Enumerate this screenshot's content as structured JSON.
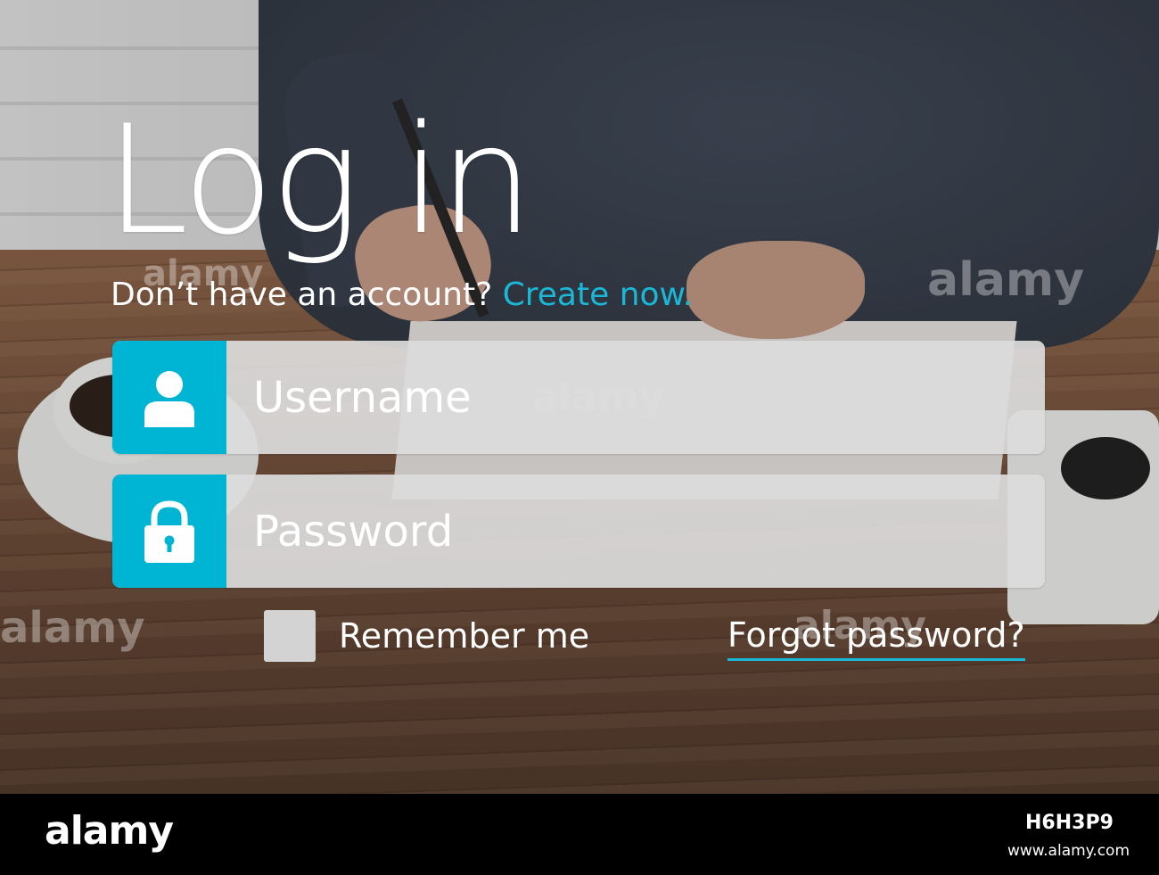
{
  "login": {
    "title": "Log in",
    "signup_prompt": "Don’t have an account?",
    "signup_link": "Create now.",
    "username_placeholder": "Username",
    "password_placeholder": "Password",
    "remember_label": "Remember me",
    "forgot_link": "Forgot password?"
  },
  "icons": {
    "username": "user-icon",
    "password": "lock-icon"
  },
  "colors": {
    "accent": "#00b4d3",
    "link": "#1ab8d6",
    "field_bg": "#dcdcdc",
    "text": "#ffffff"
  },
  "watermark": {
    "text": "alamy",
    "image_code": "H6H3P9",
    "url": "www.alamy.com"
  }
}
